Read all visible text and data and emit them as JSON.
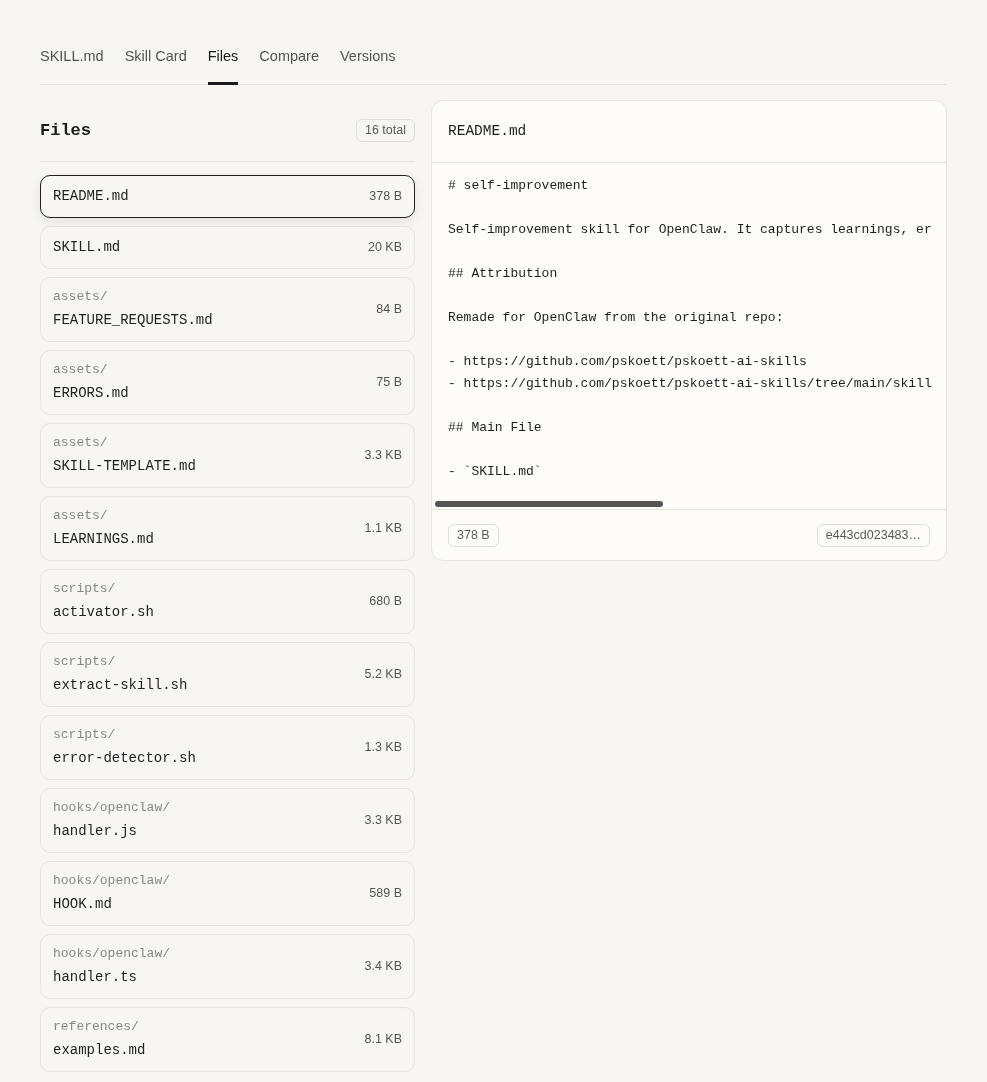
{
  "tabs": [
    {
      "label": "SKILL.md",
      "selected": false
    },
    {
      "label": "Skill Card",
      "selected": false
    },
    {
      "label": "Files",
      "selected": true
    },
    {
      "label": "Compare",
      "selected": false
    },
    {
      "label": "Versions",
      "selected": false
    }
  ],
  "files": {
    "title": "Files",
    "count": "16 total",
    "items": [
      {
        "name": "README.md",
        "size": "378 B",
        "selected": true
      },
      {
        "name": "SKILL.md",
        "size": "20 KB",
        "selected": false
      },
      {
        "folder": "assets/",
        "name": "FEATURE_REQUESTS.md",
        "size": "84 B",
        "selected": false
      },
      {
        "folder": "assets/",
        "name": "ERRORS.md",
        "size": "75 B",
        "selected": false
      },
      {
        "folder": "assets/",
        "name": "SKILL-TEMPLATE.md",
        "size": "3.3 KB",
        "selected": false
      },
      {
        "folder": "assets/",
        "name": "LEARNINGS.md",
        "size": "1.1 KB",
        "selected": false
      },
      {
        "folder": "scripts/",
        "name": "activator.sh",
        "size": "680 B",
        "selected": false
      },
      {
        "folder": "scripts/",
        "name": "extract-skill.sh",
        "size": "5.2 KB",
        "selected": false
      },
      {
        "folder": "scripts/",
        "name": "error-detector.sh",
        "size": "1.3 KB",
        "selected": false
      },
      {
        "folder": "hooks/openclaw/",
        "name": "handler.js",
        "size": "3.3 KB",
        "selected": false
      },
      {
        "folder": "hooks/openclaw/",
        "name": "HOOK.md",
        "size": "589 B",
        "selected": false
      },
      {
        "folder": "hooks/openclaw/",
        "name": "handler.ts",
        "size": "3.4 KB",
        "selected": false
      },
      {
        "folder": "references/",
        "name": "examples.md",
        "size": "8.1 KB",
        "selected": false
      }
    ]
  },
  "preview": {
    "filename": "README.md",
    "blocks": [
      [
        "# self-improvement"
      ],
      [
        "Self-improvement skill for OpenClaw. It captures learnings, er"
      ],
      [
        "## Attribution"
      ],
      [
        "Remade for OpenClaw from the original repo:"
      ],
      [
        "- https://github.com/pskoett/pskoett-ai-skills",
        "- https://github.com/pskoett/pskoett-ai-skills/tree/main/skill"
      ],
      [
        "## Main File"
      ],
      [
        "- `SKILL.md`"
      ]
    ],
    "size": "378 B",
    "hash": "e443cd023483…"
  }
}
